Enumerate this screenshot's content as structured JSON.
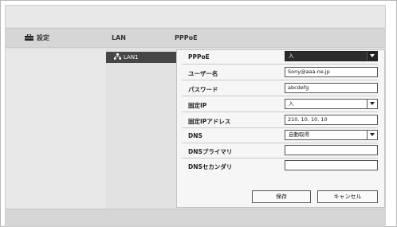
{
  "tabs": [
    {
      "label": "設定",
      "icon": "toolbox-icon"
    },
    {
      "label": "LAN"
    },
    {
      "label": "PPPoE"
    }
  ],
  "sidebar": {
    "items": [
      {
        "label": "LAN1",
        "icon": "network-icon"
      }
    ]
  },
  "form": {
    "pppoe": {
      "label": "PPPoE",
      "value": "入"
    },
    "username": {
      "label": "ユーザー名",
      "value": "Sony@aaa.ne.jp"
    },
    "password": {
      "label": "パスワード",
      "value": "abcdefg"
    },
    "fixed_ip": {
      "label": "固定IP",
      "value": "入"
    },
    "fixed_ip_address": {
      "label": "固定IPアドレス",
      "value": "210. 10. 10. 10"
    },
    "dns": {
      "label": "DNS",
      "value": "自動取得"
    },
    "dns_primary": {
      "label": "DNSプライマリ",
      "value": ""
    },
    "dns_secondary": {
      "label": "DNSセカンダリ",
      "value": ""
    }
  },
  "buttons": {
    "save": "保存",
    "cancel": "キャンセル"
  }
}
